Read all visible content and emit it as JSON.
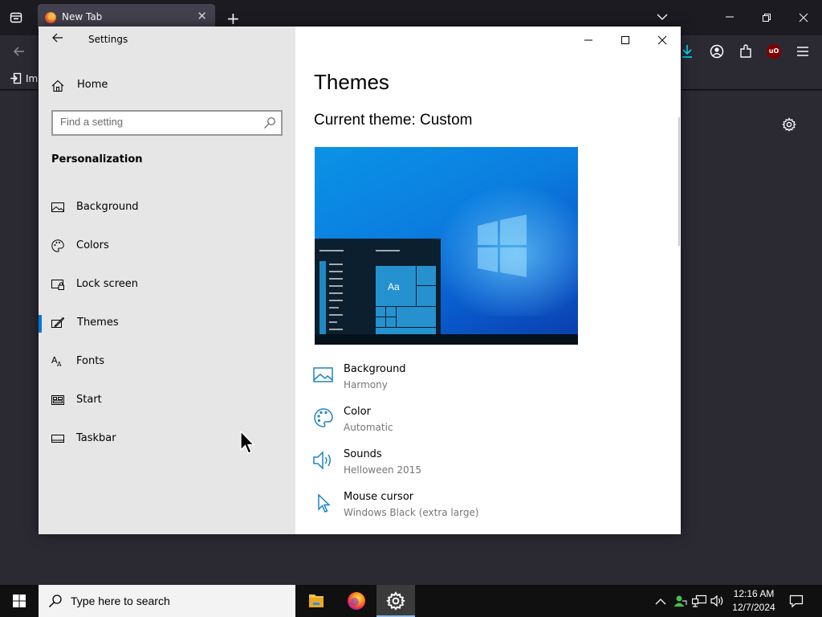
{
  "browser": {
    "tab_title": "New Tab",
    "bookmark_label": "Im"
  },
  "settings": {
    "window_title": "Settings",
    "home_label": "Home",
    "search_placeholder": "Find a setting",
    "section_title": "Personalization",
    "nav_items": [
      {
        "label": "Background",
        "icon": "image-icon"
      },
      {
        "label": "Colors",
        "icon": "palette-icon"
      },
      {
        "label": "Lock screen",
        "icon": "lock-screen-icon"
      },
      {
        "label": "Themes",
        "icon": "brush-icon",
        "active": true
      },
      {
        "label": "Fonts",
        "icon": "font-icon"
      },
      {
        "label": "Start",
        "icon": "start-icon"
      },
      {
        "label": "Taskbar",
        "icon": "taskbar-icon"
      }
    ],
    "page_title": "Themes",
    "current_theme": "Current theme: Custom",
    "preview_text": "Aa",
    "properties": [
      {
        "title": "Background",
        "value": "Harmony",
        "icon": "image-icon"
      },
      {
        "title": "Color",
        "value": "Automatic",
        "icon": "palette-icon"
      },
      {
        "title": "Sounds",
        "value": "Helloween 2015",
        "icon": "speaker-icon"
      },
      {
        "title": "Mouse cursor",
        "value": "Windows Black (extra large)",
        "icon": "cursor-icon"
      }
    ]
  },
  "taskbar": {
    "search_placeholder": "Type here to search",
    "time": "12:16 AM",
    "date": "12/7/2024",
    "pinned_apps": [
      "file-explorer",
      "firefox",
      "settings"
    ]
  },
  "colors": {
    "accent": "#0078d7",
    "property_icon": "#1f83c6"
  }
}
